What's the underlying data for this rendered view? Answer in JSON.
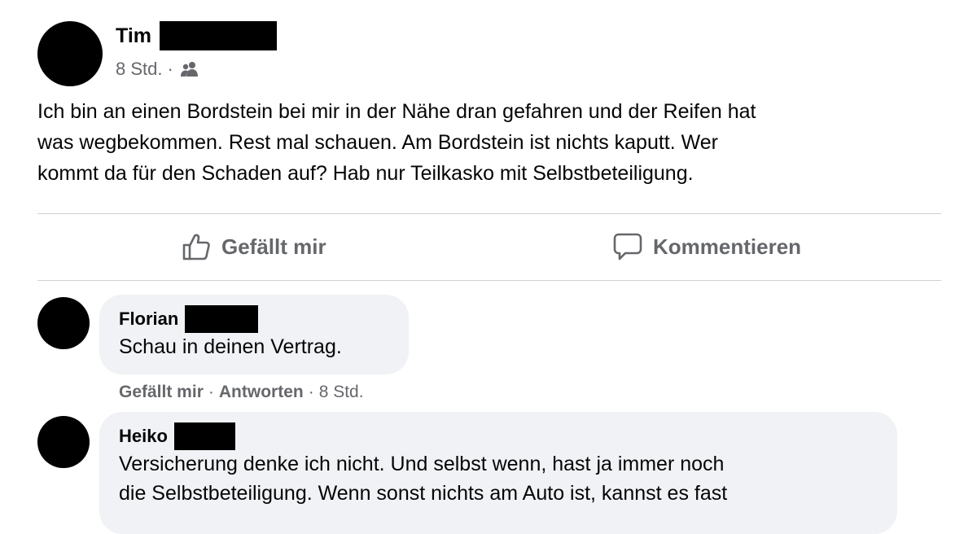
{
  "post": {
    "author": "Tim",
    "time": "8 Std.",
    "separator": "·",
    "audience_icon": "friends-icon",
    "text": "Ich bin an einen Bordstein bei mir in der Nähe dran gefahren und der Reifen hat\nwas wegbekommen. Rest mal schauen. Am Bordstein ist nichts kaputt. Wer\nkommt da für den Schaden auf? Hab nur Teilkasko mit Selbstbeteiligung."
  },
  "actions": {
    "like_label": "Gefällt mir",
    "comment_label": "Kommentieren",
    "like_icon": "thumbs-up-icon",
    "comment_icon": "comment-bubble-icon"
  },
  "comments": [
    {
      "author": "Florian",
      "text": "Schau in deinen Vertrag.",
      "like_label": "Gefällt mir",
      "reply_label": "Antworten",
      "time": "8 Std.",
      "separator": "·"
    },
    {
      "author": "Heiko",
      "text": "Versicherung denke ich nicht. Und selbst wenn, hast ja immer noch\ndie Selbstbeteiligung. Wenn sonst nichts am Auto ist, kannst es fast"
    }
  ],
  "colors": {
    "text": "#050505",
    "secondary_text": "#65676b",
    "bubble_background": "#f0f2f5",
    "divider": "#ced0d4",
    "redaction": "#000000"
  }
}
